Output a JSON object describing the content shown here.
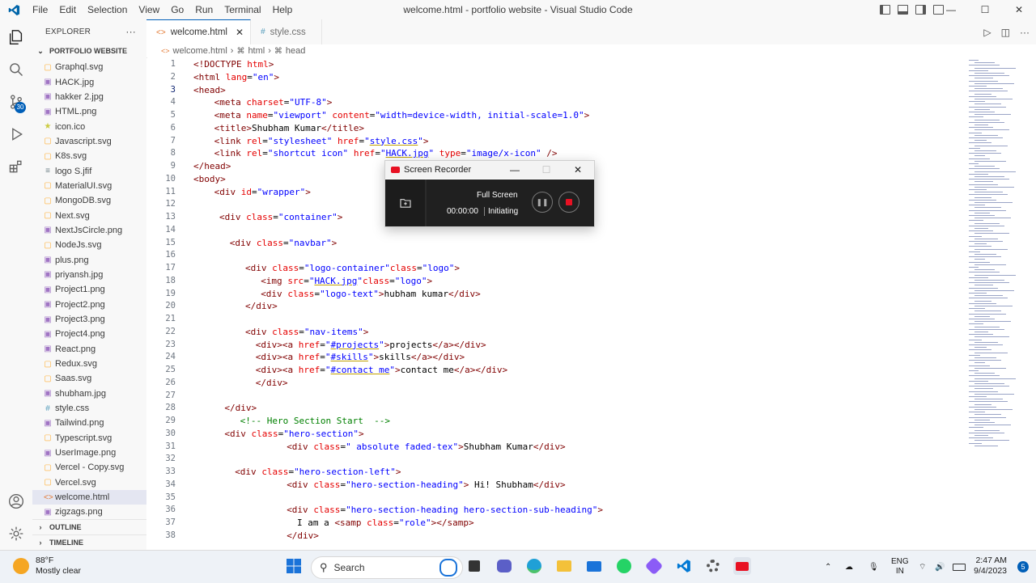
{
  "window": {
    "title": "welcome.html - portfolio website - Visual Studio Code"
  },
  "menu": [
    "File",
    "Edit",
    "Selection",
    "View",
    "Go",
    "Run",
    "Terminal",
    "Help"
  ],
  "activity_bar": {
    "source_control_badge": "30"
  },
  "explorer": {
    "header": "EXPLORER",
    "more": "···",
    "folder": "PORTFOLIO WEBSITE",
    "files": [
      {
        "name": "Graphql.svg",
        "icon": "svg-file-icon"
      },
      {
        "name": "HACK.jpg",
        "icon": "image-file-icon"
      },
      {
        "name": "hakker 2.jpg",
        "icon": "image-file-icon"
      },
      {
        "name": "HTML.png",
        "icon": "image-file-icon"
      },
      {
        "name": "icon.ico",
        "icon": "star-file-icon"
      },
      {
        "name": "Javascript.svg",
        "icon": "svg-file-icon"
      },
      {
        "name": "K8s.svg",
        "icon": "svg-file-icon"
      },
      {
        "name": "logo S.jfif",
        "icon": "generic-file-icon"
      },
      {
        "name": "MaterialUI.svg",
        "icon": "svg-file-icon"
      },
      {
        "name": "MongoDB.svg",
        "icon": "svg-file-icon"
      },
      {
        "name": "Next.svg",
        "icon": "svg-file-icon"
      },
      {
        "name": "NextJsCircle.png",
        "icon": "image-file-icon"
      },
      {
        "name": "NodeJs.svg",
        "icon": "svg-file-icon"
      },
      {
        "name": "plus.png",
        "icon": "image-file-icon"
      },
      {
        "name": "priyansh.jpg",
        "icon": "image-file-icon"
      },
      {
        "name": "Project1.png",
        "icon": "image-file-icon"
      },
      {
        "name": "Project2.png",
        "icon": "image-file-icon"
      },
      {
        "name": "Project3.png",
        "icon": "image-file-icon"
      },
      {
        "name": "Project4.png",
        "icon": "image-file-icon"
      },
      {
        "name": "React.png",
        "icon": "image-file-icon"
      },
      {
        "name": "Redux.svg",
        "icon": "svg-file-icon"
      },
      {
        "name": "Saas.svg",
        "icon": "svg-file-icon"
      },
      {
        "name": "shubham.jpg",
        "icon": "image-file-icon"
      },
      {
        "name": "style.css",
        "icon": "css-file-icon"
      },
      {
        "name": "Tailwind.png",
        "icon": "image-file-icon"
      },
      {
        "name": "Typescript.svg",
        "icon": "svg-file-icon"
      },
      {
        "name": "UserImage.png",
        "icon": "image-file-icon"
      },
      {
        "name": "Vercel - Copy.svg",
        "icon": "svg-file-icon"
      },
      {
        "name": "Vercel.svg",
        "icon": "svg-file-icon"
      },
      {
        "name": "welcome.html",
        "icon": "html-file-icon",
        "active": true
      },
      {
        "name": "zigzags.png",
        "icon": "image-file-icon"
      }
    ],
    "outline": "OUTLINE",
    "timeline": "TIMELINE"
  },
  "tabs": [
    {
      "label": "welcome.html",
      "active": true,
      "icon": "<>"
    },
    {
      "label": "style.css",
      "active": false,
      "icon": "#"
    }
  ],
  "breadcrumb": [
    "welcome.html",
    "html",
    "head"
  ],
  "code": {
    "current_line": 3,
    "lines": [
      {
        "n": 1,
        "indent": 0,
        "parts": [
          [
            "t",
            "<!DOCTYPE "
          ],
          [
            "a",
            "html"
          ],
          [
            "t",
            ">"
          ]
        ]
      },
      {
        "n": 2,
        "indent": 0,
        "parts": [
          [
            "t",
            "<html "
          ],
          [
            "a",
            "lang"
          ],
          [
            "tx",
            "="
          ],
          [
            "v",
            "\"en\""
          ],
          [
            "t",
            ">"
          ]
        ]
      },
      {
        "n": 3,
        "indent": 0,
        "parts": [
          [
            "t",
            "<head>"
          ]
        ]
      },
      {
        "n": 4,
        "indent": 4,
        "parts": [
          [
            "t",
            "<meta "
          ],
          [
            "a",
            "charset"
          ],
          [
            "tx",
            "="
          ],
          [
            "v",
            "\"UTF-8\""
          ],
          [
            "t",
            ">"
          ]
        ]
      },
      {
        "n": 5,
        "indent": 4,
        "parts": [
          [
            "t",
            "<meta "
          ],
          [
            "a",
            "name"
          ],
          [
            "tx",
            "="
          ],
          [
            "v",
            "\"viewport\" "
          ],
          [
            "a",
            "content"
          ],
          [
            "tx",
            "="
          ],
          [
            "v",
            "\"width=device-width, initial-scale=1.0\""
          ],
          [
            "t",
            ">"
          ]
        ]
      },
      {
        "n": 6,
        "indent": 4,
        "parts": [
          [
            "t",
            "<title>"
          ],
          [
            "tx",
            "Shubham Kumar"
          ],
          [
            "t",
            "</title>"
          ]
        ]
      },
      {
        "n": 7,
        "indent": 4,
        "parts": [
          [
            "t",
            "<link "
          ],
          [
            "a",
            "rel"
          ],
          [
            "tx",
            "="
          ],
          [
            "v",
            "\"stylesheet\" "
          ],
          [
            "a",
            "href"
          ],
          [
            "tx",
            "="
          ],
          [
            "v",
            "\""
          ],
          [
            "vu",
            "style.css"
          ],
          [
            "v",
            "\""
          ],
          [
            "t",
            ">"
          ]
        ]
      },
      {
        "n": 8,
        "indent": 4,
        "parts": [
          [
            "t",
            "<link "
          ],
          [
            "a",
            "rel"
          ],
          [
            "tx",
            "="
          ],
          [
            "v",
            "\"shortcut icon\" "
          ],
          [
            "a",
            "href"
          ],
          [
            "tx",
            "="
          ],
          [
            "v",
            "\""
          ],
          [
            "vu",
            "HACK.jpg"
          ],
          [
            "v",
            "\" "
          ],
          [
            "a",
            "type"
          ],
          [
            "tx",
            "="
          ],
          [
            "v",
            "\"image/x-icon\" "
          ],
          [
            "t",
            "/>"
          ]
        ]
      },
      {
        "n": 9,
        "indent": 0,
        "parts": [
          [
            "t",
            "</head>"
          ]
        ]
      },
      {
        "n": 10,
        "indent": 0,
        "parts": [
          [
            "t",
            "<body>"
          ]
        ]
      },
      {
        "n": 11,
        "indent": 4,
        "parts": [
          [
            "t",
            "<div "
          ],
          [
            "a",
            "id"
          ],
          [
            "tx",
            "="
          ],
          [
            "v",
            "\"wrapper\""
          ],
          [
            "t",
            ">"
          ]
        ]
      },
      {
        "n": 12,
        "indent": 0,
        "parts": []
      },
      {
        "n": 13,
        "indent": 5,
        "parts": [
          [
            "t",
            "<div "
          ],
          [
            "a",
            "class"
          ],
          [
            "tx",
            "="
          ],
          [
            "v",
            "\"container\""
          ],
          [
            "t",
            ">"
          ]
        ]
      },
      {
        "n": 14,
        "indent": 0,
        "parts": []
      },
      {
        "n": 15,
        "indent": 7,
        "parts": [
          [
            "t",
            "<div "
          ],
          [
            "a",
            "class"
          ],
          [
            "tx",
            "="
          ],
          [
            "v",
            "\"navbar\""
          ],
          [
            "t",
            ">"
          ]
        ]
      },
      {
        "n": 16,
        "indent": 0,
        "parts": []
      },
      {
        "n": 17,
        "indent": 10,
        "parts": [
          [
            "t",
            "<div "
          ],
          [
            "a",
            "class"
          ],
          [
            "tx",
            "="
          ],
          [
            "v",
            "\"logo-container\""
          ],
          [
            "a",
            "class"
          ],
          [
            "tx",
            "="
          ],
          [
            "v",
            "\"logo\""
          ],
          [
            "t",
            ">"
          ]
        ]
      },
      {
        "n": 18,
        "indent": 13,
        "parts": [
          [
            "t",
            "<img "
          ],
          [
            "a",
            "src"
          ],
          [
            "tx",
            "="
          ],
          [
            "v",
            "\""
          ],
          [
            "vu",
            "HACK.jpg"
          ],
          [
            "v",
            "\""
          ],
          [
            "a",
            "class"
          ],
          [
            "tx",
            "="
          ],
          [
            "v",
            "\"logo\""
          ],
          [
            "t",
            ">"
          ]
        ]
      },
      {
        "n": 19,
        "indent": 13,
        "parts": [
          [
            "t",
            "<div "
          ],
          [
            "a",
            "class"
          ],
          [
            "tx",
            "="
          ],
          [
            "v",
            "\"logo-text\""
          ],
          [
            "t",
            ">"
          ],
          [
            "tx",
            "hubham kumar"
          ],
          [
            "t",
            "</div>"
          ]
        ]
      },
      {
        "n": 20,
        "indent": 10,
        "parts": [
          [
            "t",
            "</div>"
          ]
        ]
      },
      {
        "n": 21,
        "indent": 0,
        "parts": []
      },
      {
        "n": 22,
        "indent": 10,
        "parts": [
          [
            "t",
            "<div "
          ],
          [
            "a",
            "class"
          ],
          [
            "tx",
            "="
          ],
          [
            "v",
            "\"nav-items\""
          ],
          [
            "t",
            ">"
          ]
        ]
      },
      {
        "n": 23,
        "indent": 12,
        "parts": [
          [
            "t",
            "<div><a "
          ],
          [
            "a",
            "href"
          ],
          [
            "tx",
            "="
          ],
          [
            "v",
            "\""
          ],
          [
            "vu",
            "#projects"
          ],
          [
            "v",
            "\""
          ],
          [
            "t",
            ">"
          ],
          [
            "tx",
            "projects"
          ],
          [
            "t",
            "</a></div>"
          ]
        ]
      },
      {
        "n": 24,
        "indent": 12,
        "parts": [
          [
            "t",
            "<div><a "
          ],
          [
            "a",
            "href"
          ],
          [
            "tx",
            "="
          ],
          [
            "v",
            "\""
          ],
          [
            "vu",
            "#skills"
          ],
          [
            "v",
            "\""
          ],
          [
            "t",
            ">"
          ],
          [
            "tx",
            "skills"
          ],
          [
            "t",
            "</a></div>"
          ]
        ]
      },
      {
        "n": 25,
        "indent": 12,
        "parts": [
          [
            "t",
            "<div><a "
          ],
          [
            "a",
            "href"
          ],
          [
            "tx",
            "="
          ],
          [
            "v",
            "\""
          ],
          [
            "vu",
            "#contact me"
          ],
          [
            "v",
            "\""
          ],
          [
            "t",
            ">"
          ],
          [
            "tx",
            "contact me"
          ],
          [
            "t",
            "</a></div>"
          ]
        ]
      },
      {
        "n": 26,
        "indent": 12,
        "parts": [
          [
            "t",
            "</div>"
          ]
        ]
      },
      {
        "n": 27,
        "indent": 0,
        "parts": []
      },
      {
        "n": 28,
        "indent": 6,
        "parts": [
          [
            "t",
            "</div>"
          ]
        ]
      },
      {
        "n": 29,
        "indent": 9,
        "parts": [
          [
            "cm",
            "<!-- Hero Section Start  -->"
          ]
        ]
      },
      {
        "n": 30,
        "indent": 6,
        "parts": [
          [
            "t",
            "<div "
          ],
          [
            "a",
            "class"
          ],
          [
            "tx",
            "="
          ],
          [
            "v",
            "\"hero-section\""
          ],
          [
            "t",
            ">"
          ]
        ]
      },
      {
        "n": 31,
        "indent": 18,
        "parts": [
          [
            "t",
            "<div "
          ],
          [
            "a",
            "class"
          ],
          [
            "tx",
            "="
          ],
          [
            "v",
            "\" absolute faded-tex\""
          ],
          [
            "t",
            ">"
          ],
          [
            "tx",
            "Shubham Kumar"
          ],
          [
            "t",
            "</div>"
          ]
        ]
      },
      {
        "n": 32,
        "indent": 0,
        "parts": []
      },
      {
        "n": 33,
        "indent": 8,
        "parts": [
          [
            "t",
            "<div "
          ],
          [
            "a",
            "class"
          ],
          [
            "tx",
            "="
          ],
          [
            "v",
            "\"hero-section-left\""
          ],
          [
            "t",
            ">"
          ]
        ]
      },
      {
        "n": 34,
        "indent": 18,
        "parts": [
          [
            "t",
            "<div "
          ],
          [
            "a",
            "class"
          ],
          [
            "tx",
            "="
          ],
          [
            "v",
            "\"hero-section-heading\""
          ],
          [
            "t",
            ">"
          ],
          [
            "tx",
            " Hi! Shubham"
          ],
          [
            "t",
            "</div>"
          ]
        ]
      },
      {
        "n": 35,
        "indent": 0,
        "parts": []
      },
      {
        "n": 36,
        "indent": 18,
        "parts": [
          [
            "t",
            "<div "
          ],
          [
            "a",
            "class"
          ],
          [
            "tx",
            "="
          ],
          [
            "v",
            "\"hero-section-heading hero-section-sub-heading\""
          ],
          [
            "t",
            ">"
          ]
        ]
      },
      {
        "n": 37,
        "indent": 20,
        "parts": [
          [
            "tx",
            "I am a "
          ],
          [
            "t",
            "<samp "
          ],
          [
            "a",
            "class"
          ],
          [
            "tx",
            "="
          ],
          [
            "v",
            "\"role\""
          ],
          [
            "t",
            "></samp>"
          ]
        ]
      },
      {
        "n": 38,
        "indent": 18,
        "parts": [
          [
            "t",
            "</div>"
          ]
        ]
      }
    ]
  },
  "recorder": {
    "title": "Screen Recorder",
    "mode": "Full Screen",
    "time": "00:00:00",
    "status": "Initiating",
    "accent": "#e81123"
  },
  "taskbar": {
    "weather_temp": "88°F",
    "weather_desc": "Mostly clear",
    "search_placeholder": "Search",
    "lang_line1": "ENG",
    "lang_line2": "IN",
    "time": "2:47 AM",
    "date": "9/4/2023",
    "notifications": "5"
  },
  "colors": {
    "accent": "#005fb8",
    "tag": "#800000",
    "attr": "#e50000",
    "value": "#0000ff",
    "comment": "#008000"
  }
}
